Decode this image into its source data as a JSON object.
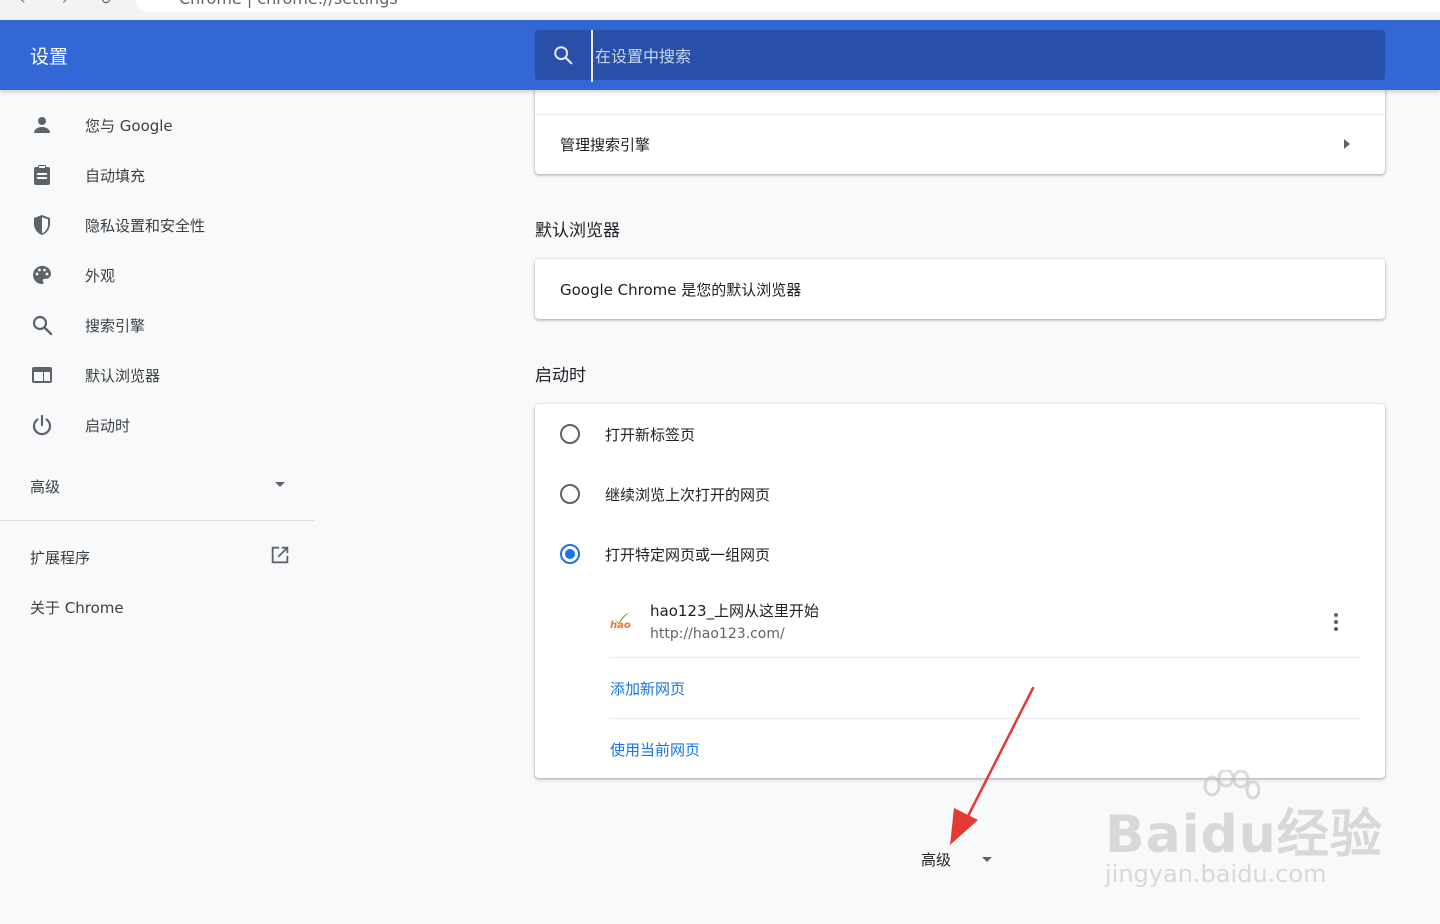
{
  "browser": {
    "address": "Chrome | chrome://settings"
  },
  "header": {
    "title": "设置",
    "search_placeholder": "在设置中搜索"
  },
  "sidebar": {
    "items": [
      {
        "label": "您与 Google",
        "icon": "person-icon"
      },
      {
        "label": "自动填充",
        "icon": "clipboard-icon"
      },
      {
        "label": "隐私设置和安全性",
        "icon": "shield-icon"
      },
      {
        "label": "外观",
        "icon": "palette-icon"
      },
      {
        "label": "搜索引擎",
        "icon": "search-icon"
      },
      {
        "label": "默认浏览器",
        "icon": "browser-window-icon"
      },
      {
        "label": "启动时",
        "icon": "power-icon"
      }
    ],
    "advanced_label": "高级",
    "extensions_label": "扩展程序",
    "about_label": "关于 Chrome"
  },
  "search_engine": {
    "manage_label": "管理搜索引擎"
  },
  "default_browser": {
    "section_title": "默认浏览器",
    "status_text": "Google Chrome 是您的默认浏览器"
  },
  "startup": {
    "section_title": "启动时",
    "options": [
      {
        "label": "打开新标签页",
        "checked": false
      },
      {
        "label": "继续浏览上次打开的网页",
        "checked": false
      },
      {
        "label": "打开特定网页或一组网页",
        "checked": true
      }
    ],
    "page": {
      "title": "hao123_上网从这里开始",
      "url": "http://hao123.com/",
      "favicon_text": "hao"
    },
    "add_page_label": "添加新网页",
    "use_current_label": "使用当前网页"
  },
  "footer": {
    "advanced_label": "高级"
  },
  "watermark": {
    "logo": "Baidu经验",
    "sub": "jingyan.baidu.com"
  },
  "colors": {
    "header_blue": "#3367d6",
    "link_blue": "#1a73e8",
    "annotation_red": "#e53935"
  }
}
